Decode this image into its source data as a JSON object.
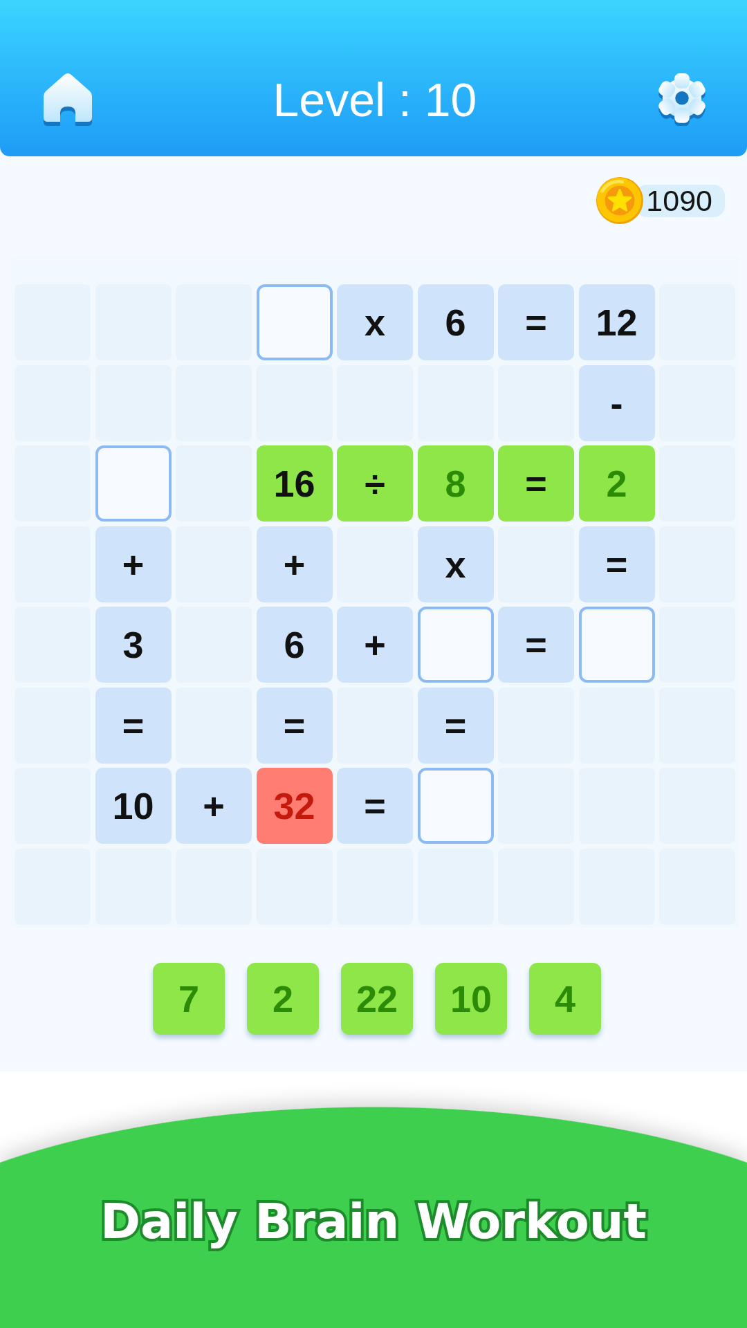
{
  "header": {
    "title": "Level : 10"
  },
  "coins": {
    "count": "1090"
  },
  "board": {
    "rows": [
      {
        "cells": [
          {
            "kind": "empty"
          },
          {
            "kind": "empty"
          },
          {
            "kind": "empty"
          },
          {
            "kind": "slot"
          },
          {
            "kind": "given",
            "text": "x",
            "solved": false
          },
          {
            "kind": "given",
            "text": "6",
            "solved": false
          },
          {
            "kind": "given",
            "text": "=",
            "solved": false
          },
          {
            "kind": "given",
            "text": "12",
            "solved": false
          },
          {
            "kind": "empty"
          }
        ]
      },
      {
        "cells": [
          {
            "kind": "empty"
          },
          {
            "kind": "empty"
          },
          {
            "kind": "empty"
          },
          {
            "kind": "empty"
          },
          {
            "kind": "empty"
          },
          {
            "kind": "empty"
          },
          {
            "kind": "empty"
          },
          {
            "kind": "given",
            "text": "-",
            "solved": false
          },
          {
            "kind": "empty"
          }
        ]
      },
      {
        "cells": [
          {
            "kind": "empty"
          },
          {
            "kind": "slot"
          },
          {
            "kind": "empty"
          },
          {
            "kind": "given",
            "text": "16",
            "solved": true
          },
          {
            "kind": "given",
            "text": "÷",
            "solved": true
          },
          {
            "kind": "placed",
            "text": "8",
            "solved": true,
            "wrong": false
          },
          {
            "kind": "given",
            "text": "=",
            "solved": true
          },
          {
            "kind": "placed",
            "text": "2",
            "solved": true,
            "wrong": false
          },
          {
            "kind": "empty"
          }
        ]
      },
      {
        "cells": [
          {
            "kind": "empty"
          },
          {
            "kind": "given",
            "text": "+",
            "solved": false
          },
          {
            "kind": "empty"
          },
          {
            "kind": "given",
            "text": "+",
            "solved": false
          },
          {
            "kind": "empty"
          },
          {
            "kind": "given",
            "text": "x",
            "solved": false
          },
          {
            "kind": "empty"
          },
          {
            "kind": "given",
            "text": "=",
            "solved": false
          },
          {
            "kind": "empty"
          }
        ]
      },
      {
        "cells": [
          {
            "kind": "empty"
          },
          {
            "kind": "given",
            "text": "3",
            "solved": false
          },
          {
            "kind": "empty"
          },
          {
            "kind": "given",
            "text": "6",
            "solved": false
          },
          {
            "kind": "given",
            "text": "+",
            "solved": false
          },
          {
            "kind": "slot"
          },
          {
            "kind": "given",
            "text": "=",
            "solved": false
          },
          {
            "kind": "slot"
          },
          {
            "kind": "empty"
          }
        ]
      },
      {
        "cells": [
          {
            "kind": "empty"
          },
          {
            "kind": "given",
            "text": "=",
            "solved": false
          },
          {
            "kind": "empty"
          },
          {
            "kind": "given",
            "text": "=",
            "solved": false
          },
          {
            "kind": "empty"
          },
          {
            "kind": "given",
            "text": "=",
            "solved": false
          },
          {
            "kind": "empty"
          },
          {
            "kind": "empty"
          },
          {
            "kind": "empty"
          }
        ]
      },
      {
        "cells": [
          {
            "kind": "empty"
          },
          {
            "kind": "given",
            "text": "10",
            "solved": false
          },
          {
            "kind": "given",
            "text": "+",
            "solved": false
          },
          {
            "kind": "placed",
            "text": "32",
            "solved": false,
            "wrong": true
          },
          {
            "kind": "given",
            "text": "=",
            "solved": false
          },
          {
            "kind": "slot"
          },
          {
            "kind": "empty"
          },
          {
            "kind": "empty"
          },
          {
            "kind": "empty"
          }
        ]
      },
      {
        "cells": [
          {
            "kind": "empty"
          },
          {
            "kind": "empty"
          },
          {
            "kind": "empty"
          },
          {
            "kind": "empty"
          },
          {
            "kind": "empty"
          },
          {
            "kind": "empty"
          },
          {
            "kind": "empty"
          },
          {
            "kind": "empty"
          },
          {
            "kind": "empty"
          }
        ]
      }
    ]
  },
  "options": [
    "7",
    "2",
    "22",
    "10",
    "4"
  ],
  "banner": {
    "text": "Daily Brain Workout"
  }
}
